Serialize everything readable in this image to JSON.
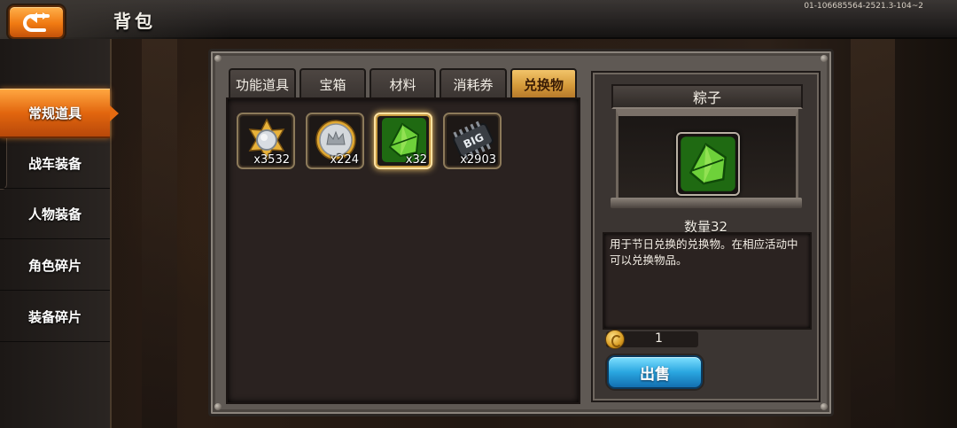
{
  "header": {
    "title": "背包",
    "version": "01-106685564-2521.3-104~2",
    "back_icon": "back-arrow-icon"
  },
  "sidebar": {
    "items": [
      {
        "label": "常规道具",
        "active": true
      },
      {
        "label": "战车装备",
        "active": false
      },
      {
        "label": "人物装备",
        "active": false
      },
      {
        "label": "角色碎片",
        "active": false
      },
      {
        "label": "装备碎片",
        "active": false
      }
    ]
  },
  "tabs": [
    {
      "label": "功能道具",
      "active": false
    },
    {
      "label": "宝箱",
      "active": false
    },
    {
      "label": "材料",
      "active": false
    },
    {
      "label": "消耗券",
      "active": false
    },
    {
      "label": "兑换物",
      "active": true
    }
  ],
  "inventory": [
    {
      "icon": "gold-star-medal-icon",
      "count": "x3532",
      "selected": false
    },
    {
      "icon": "silver-crown-coin-icon",
      "count": "x224",
      "selected": false
    },
    {
      "icon": "zongzi-leaf-icon",
      "count": "x32",
      "selected": true
    },
    {
      "icon": "big-chip-icon",
      "count": "x2903",
      "selected": false
    }
  ],
  "detail": {
    "name": "粽子",
    "icon": "zongzi-leaf-icon",
    "quantity": "数量32",
    "description": "用于节日兑换的兑换物。在相应活动中可以兑换物品。",
    "price": "1",
    "currency_icon": "gold-coin-icon",
    "sell_label": "出售"
  },
  "colors": {
    "accent_orange": "#e2660e",
    "tab_active": "#d59a3a",
    "sell_blue": "#2aa6e0"
  }
}
